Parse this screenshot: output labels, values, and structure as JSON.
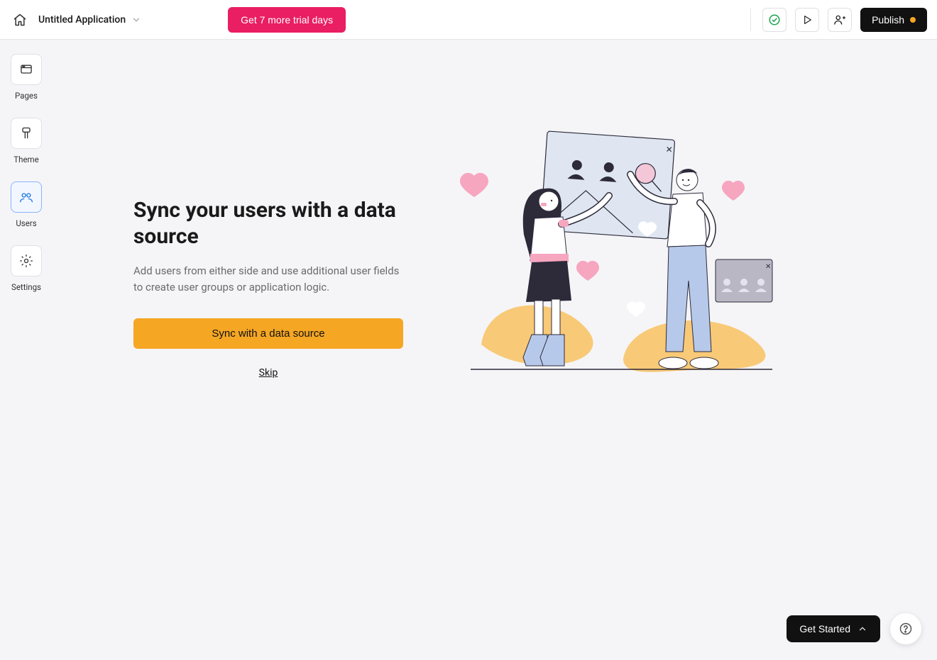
{
  "header": {
    "app_title": "Untitled Application",
    "trial_label": "Get 7 more trial days",
    "publish_label": "Publish"
  },
  "sidebar": {
    "items": [
      {
        "id": "pages",
        "label": "Pages",
        "icon": "pages-icon",
        "active": false
      },
      {
        "id": "theme",
        "label": "Theme",
        "icon": "theme-icon",
        "active": false
      },
      {
        "id": "users",
        "label": "Users",
        "icon": "users-icon",
        "active": true
      },
      {
        "id": "settings",
        "label": "Settings",
        "icon": "settings-icon",
        "active": false
      }
    ]
  },
  "main": {
    "title": "Sync your users with a data source",
    "description": "Add users from either side and use additional user fields to create user groups or application logic.",
    "sync_label": "Sync with a data source",
    "skip_label": "Skip"
  },
  "footer": {
    "get_started_label": "Get Started"
  },
  "colors": {
    "accent_pink": "#e91e63",
    "accent_amber": "#f5a623",
    "accent_blue": "#1a73e8",
    "dark": "#111111",
    "success": "#16a34a"
  }
}
